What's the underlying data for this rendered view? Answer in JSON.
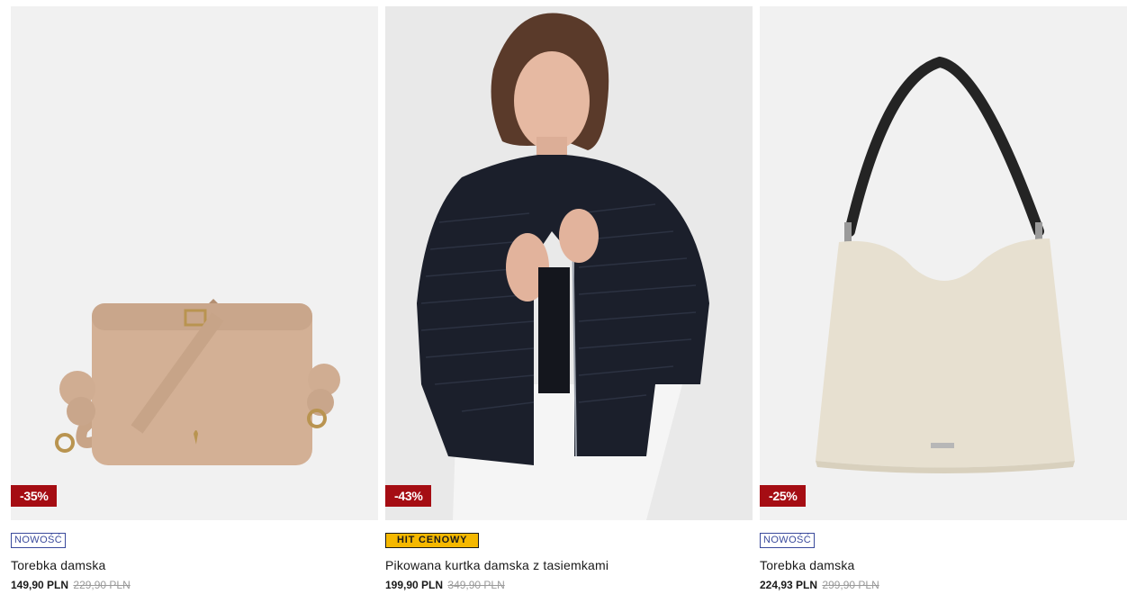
{
  "products": [
    {
      "discount": "-35%",
      "badge": "NOWOŚĆ",
      "name": "Torebka damska",
      "price": "149,90 PLN",
      "old_price": "229,90 PLN"
    },
    {
      "discount": "-43%",
      "badge": "HIT CENOWY",
      "name": "Pikowana kurtka damska z tasiemkami",
      "price": "199,90 PLN",
      "old_price": "349,90 PLN"
    },
    {
      "discount": "-25%",
      "badge": "NOWOŚĆ",
      "name": "Torebka damska",
      "price": "224,93 PLN",
      "old_price": "299,90 PLN"
    }
  ],
  "colors": {
    "discount_bg": "#a50d13",
    "hit_badge_bg": "#f5b800",
    "new_badge_border": "#3a4a9c",
    "image_bg": "#f1f1f1"
  }
}
